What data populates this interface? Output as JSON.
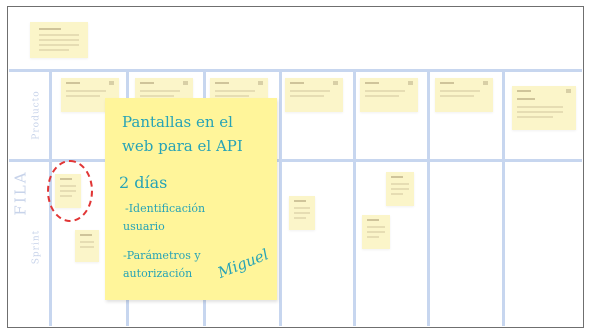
{
  "board": {
    "lanes": {
      "vertical": "FILA",
      "top": "Producto",
      "bottom": "Sprint"
    }
  },
  "note": {
    "title_line1": "Pantallas en el",
    "title_line2": "web para el API",
    "duration": "2 días",
    "item1_line1": "-Identificación",
    "item1_line2": "usuario",
    "item2_line1": "-Parámetros y",
    "item2_line2": "autorización",
    "signature": "Miguel"
  },
  "colors": {
    "note": "#fff59a",
    "handwriting": "#27a3b6",
    "grid": "#c7d6ef",
    "mini_note": "#fbf5c9",
    "highlight": "#e13535"
  }
}
